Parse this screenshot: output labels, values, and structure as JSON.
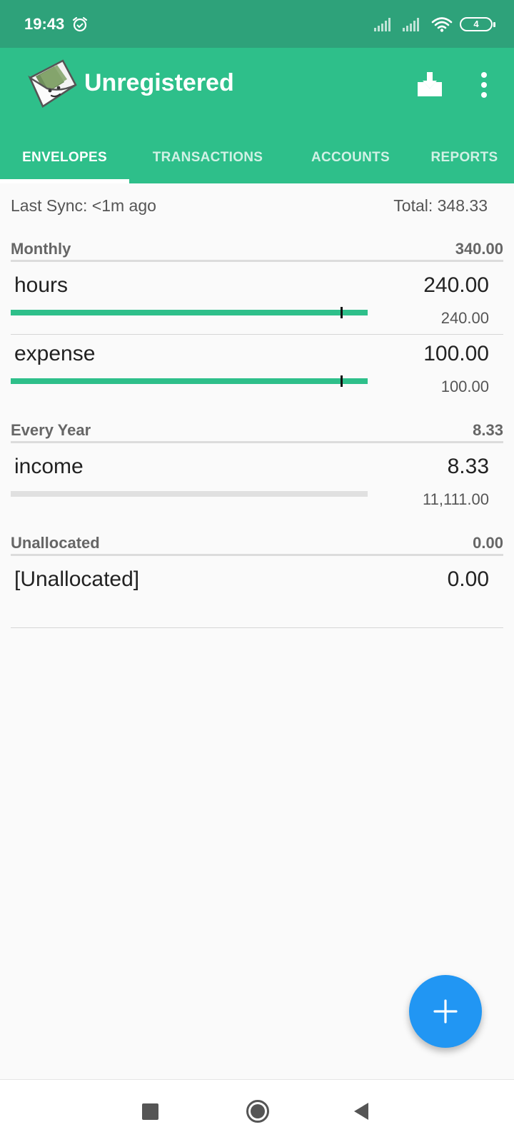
{
  "status_bar": {
    "time": "19:43",
    "battery_level": "4",
    "icons": [
      "alarm-icon",
      "signal-icon",
      "signal-icon",
      "wifi-icon",
      "battery-icon"
    ]
  },
  "app_bar": {
    "title": "Unregistered",
    "icons": [
      "envelope-logo-icon",
      "download-inbox-icon",
      "more-vert-icon"
    ],
    "accent_color": "#2ebf8a",
    "status_color": "#2ea27a"
  },
  "tabs": [
    {
      "label": "ENVELOPES",
      "active": true
    },
    {
      "label": "TRANSACTIONS",
      "active": false
    },
    {
      "label": "ACCOUNTS",
      "active": false
    },
    {
      "label": "REPORTS",
      "active": false
    }
  ],
  "summary": {
    "last_sync": "Last Sync: <1m ago",
    "total": "Total: 348.33"
  },
  "groups": [
    {
      "name": "Monthly",
      "total": "340.00",
      "envelopes": [
        {
          "name": "hours",
          "amount": "240.00",
          "budget": "240.00",
          "progress": 1.0
        },
        {
          "name": "expense",
          "amount": "100.00",
          "budget": "100.00",
          "progress": 1.0
        }
      ]
    },
    {
      "name": "Every Year",
      "total": "8.33",
      "envelopes": [
        {
          "name": "income",
          "amount": "8.33",
          "budget": "11,111.00",
          "progress": 0.0
        }
      ]
    },
    {
      "name": "Unallocated",
      "total": "0.00",
      "envelopes": [
        {
          "name": "[Unallocated]",
          "amount": "0.00"
        }
      ]
    }
  ],
  "fab": {
    "icon": "plus-icon",
    "color": "#2196f3"
  },
  "nav_bar": {
    "icons": [
      "recents-square-icon",
      "home-circle-icon",
      "back-triangle-icon"
    ]
  }
}
